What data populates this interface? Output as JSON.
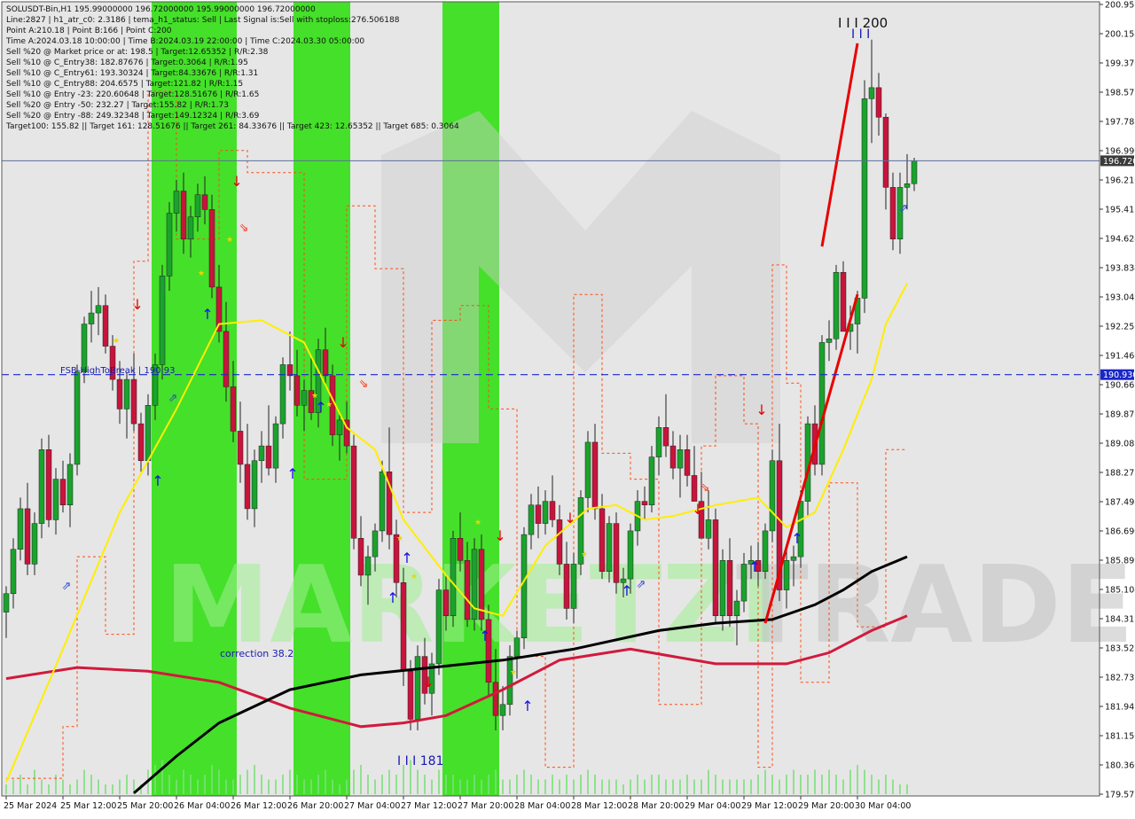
{
  "colors": {
    "background": "#ffffff",
    "plot_background": "#e6e6e6",
    "green_zone": "#45e02a",
    "bull_candle": "#1aa32c",
    "bear_candle": "#c8143c",
    "candle_wick": "#222222",
    "ma_yellow": "#ffee00",
    "ma_red": "#d11a3c",
    "ma_black": "#000000",
    "trend_red": "#e80000",
    "envelope": "#ff4a12",
    "volume": "#7be07b",
    "fsb_line": "#1a26c8",
    "price_label_bg": "#1a26c8",
    "current_label_bg": "#3a3a3a",
    "info_text": "#111111",
    "blue_text": "#1a1ab4",
    "watermark": "#d0d0d0",
    "watermark_green": "#9fef90"
  },
  "header_lines": [
    "SOLUSDT-Bin,H1  195.99000000 196.72000000 195.99000000 196.72000000",
    "Line:2827  |  h1_atr_c0: 2.3186  |  tema_h1_status: Sell  |  Last Signal is:Sell with stoploss:276.506188",
    "Point A:210.18  |  Point B:166  |  Point C:200",
    "Time A:2024.03.18 10:00:00  |  Time B:2024.03.19 22:00:00  |  Time C:2024.03.30 05:00:00",
    "Sell %20 @ Market price or at: 198.5  |  Target:12.65352  |  R/R:2.38",
    "Sell %10 @ C_Entry38: 182.87676  |  Target:0.3064  |  R/R:1.95",
    "Sell %10 @ C_Entry61: 193.30324  |  Target:84.33676  |  R/R:1.31",
    "Sell %10 @ C_Entry88: 204.6575  |  Target:121.82  |  R/R:1.15",
    "Sell %10 @ Entry -23: 220.60648  |  Target:128.51676  |  R/R:1.65",
    "Sell %20 @ Entry -50: 232.27  |  Target:155.82  |  R/R:1.73",
    "Sell %20 @ Entry -88: 249.32348  |  Target:149.12324  |  R/R:3.69",
    "Target100: 155.82  ||  Target 161: 128.51676  ||  Target 261: 84.33676  ||  Target 423: 12.65352  ||  Target 685: 0.3064"
  ],
  "watermark": {
    "text_left": "MARKETZI",
    "text_right": "TRADE"
  },
  "annotations": {
    "fsb_label": "FSB-HighToBreak | 190.93",
    "correction": "correction 38.2",
    "point_b": "I I I 181",
    "point_c": "I I I 200",
    "point_c_marks": "I I I"
  },
  "price_labels": {
    "current": "196.720",
    "fsb": "190.930"
  },
  "chart_data": {
    "type": "candlestick",
    "symbol": "SOLUSDT-Bin",
    "timeframe": "H1",
    "ylim": [
      179.571,
      200.953
    ],
    "y_ticks": [
      "200.953",
      "200.158",
      "199.370",
      "198.575",
      "197.788",
      "196.999",
      "196.210",
      "195.415",
      "194.624",
      "193.834",
      "193.042",
      "192.253",
      "191.460",
      "190.669",
      "189.876",
      "189.085",
      "188.272",
      "187.498",
      "186.690",
      "185.899",
      "185.108",
      "184.317",
      "183.525",
      "182.733",
      "181.941",
      "181.150",
      "180.360",
      "179.571"
    ],
    "x_ticks": [
      "25 Mar 2024",
      "25 Mar 12:00",
      "25 Mar 20:00",
      "26 Mar 04:00",
      "26 Mar 12:00",
      "26 Mar 20:00",
      "27 Mar 04:00",
      "27 Mar 12:00",
      "27 Mar 20:00",
      "28 Mar 04:00",
      "28 Mar 12:00",
      "28 Mar 20:00",
      "29 Mar 04:00",
      "29 Mar 12:00",
      "29 Mar 20:00",
      "30 Mar 04:00"
    ],
    "current_price": 196.72,
    "fsb_level": 190.93,
    "bars_per_tick": 8,
    "candles_ohlc": [
      [
        184.5,
        185.2,
        183.8,
        185.0
      ],
      [
        185.0,
        186.5,
        184.6,
        186.2
      ],
      [
        186.2,
        187.6,
        185.9,
        187.3
      ],
      [
        187.3,
        188.0,
        185.5,
        185.8
      ],
      [
        185.8,
        187.2,
        185.5,
        186.9
      ],
      [
        186.9,
        189.2,
        186.5,
        188.9
      ],
      [
        188.9,
        189.3,
        186.8,
        187.0
      ],
      [
        187.0,
        188.4,
        186.6,
        188.1
      ],
      [
        188.1,
        188.6,
        187.2,
        187.4
      ],
      [
        187.4,
        188.8,
        186.8,
        188.5
      ],
      [
        188.5,
        191.2,
        188.2,
        191.0
      ],
      [
        191.0,
        192.5,
        190.7,
        192.3
      ],
      [
        192.3,
        193.2,
        191.8,
        192.6
      ],
      [
        192.6,
        193.3,
        192.0,
        192.8
      ],
      [
        192.8,
        193.1,
        191.5,
        191.7
      ],
      [
        191.7,
        192.0,
        190.5,
        190.8
      ],
      [
        190.8,
        191.3,
        189.6,
        190.0
      ],
      [
        190.0,
        191.0,
        189.2,
        190.8
      ],
      [
        190.8,
        191.5,
        189.4,
        189.6
      ],
      [
        189.6,
        189.9,
        188.3,
        188.6
      ],
      [
        188.6,
        190.4,
        188.2,
        190.1
      ],
      [
        190.1,
        191.5,
        189.7,
        191.2
      ],
      [
        191.2,
        193.9,
        190.8,
        193.6
      ],
      [
        193.6,
        195.6,
        193.2,
        195.3
      ],
      [
        195.3,
        196.2,
        194.8,
        195.9
      ],
      [
        195.9,
        196.4,
        194.2,
        194.6
      ],
      [
        194.6,
        195.5,
        194.1,
        195.2
      ],
      [
        195.2,
        196.1,
        194.8,
        195.8
      ],
      [
        195.8,
        196.3,
        195.0,
        195.4
      ],
      [
        195.4,
        195.8,
        193.0,
        193.3
      ],
      [
        193.3,
        193.9,
        191.8,
        192.1
      ],
      [
        192.1,
        192.9,
        190.2,
        190.6
      ],
      [
        190.6,
        191.3,
        189.1,
        189.4
      ],
      [
        189.4,
        190.2,
        188.0,
        188.5
      ],
      [
        188.5,
        189.6,
        187.0,
        187.3
      ],
      [
        187.3,
        188.9,
        186.8,
        188.6
      ],
      [
        188.6,
        189.4,
        188.0,
        189.0
      ],
      [
        189.0,
        190.1,
        188.2,
        188.4
      ],
      [
        188.4,
        189.8,
        188.0,
        189.6
      ],
      [
        189.6,
        191.4,
        189.2,
        191.2
      ],
      [
        191.2,
        192.1,
        190.5,
        190.9
      ],
      [
        190.9,
        191.6,
        189.8,
        190.1
      ],
      [
        190.1,
        190.8,
        189.4,
        190.5
      ],
      [
        190.5,
        191.4,
        189.7,
        189.9
      ],
      [
        189.9,
        191.9,
        189.5,
        191.6
      ],
      [
        191.6,
        192.2,
        190.6,
        190.9
      ],
      [
        190.9,
        191.2,
        189.0,
        189.3
      ],
      [
        189.3,
        189.9,
        188.6,
        189.7
      ],
      [
        189.7,
        190.2,
        188.8,
        189.0
      ],
      [
        189.0,
        189.3,
        186.2,
        186.5
      ],
      [
        186.5,
        187.1,
        185.2,
        185.5
      ],
      [
        185.5,
        186.3,
        184.7,
        186.0
      ],
      [
        186.0,
        186.9,
        185.6,
        186.7
      ],
      [
        186.7,
        188.6,
        186.4,
        188.3
      ],
      [
        188.3,
        189.5,
        186.2,
        186.6
      ],
      [
        186.6,
        187.0,
        184.9,
        185.3
      ],
      [
        185.3,
        185.7,
        182.5,
        182.9
      ],
      [
        182.9,
        183.2,
        181.3,
        181.6
      ],
      [
        181.6,
        183.6,
        181.3,
        183.3
      ],
      [
        183.3,
        183.8,
        182.0,
        182.3
      ],
      [
        182.3,
        183.4,
        181.7,
        183.1
      ],
      [
        183.1,
        185.4,
        182.8,
        185.1
      ],
      [
        185.1,
        185.5,
        184.0,
        184.4
      ],
      [
        184.4,
        186.7,
        184.1,
        186.5
      ],
      [
        186.5,
        187.2,
        185.6,
        185.9
      ],
      [
        185.9,
        186.4,
        184.1,
        184.3
      ],
      [
        184.3,
        186.5,
        184.0,
        186.2
      ],
      [
        186.2,
        186.6,
        184.0,
        184.3
      ],
      [
        184.3,
        184.7,
        182.2,
        182.6
      ],
      [
        182.6,
        183.5,
        181.3,
        181.7
      ],
      [
        181.7,
        182.5,
        181.3,
        182.0
      ],
      [
        182.0,
        183.6,
        181.7,
        183.3
      ],
      [
        183.3,
        184.0,
        182.7,
        183.8
      ],
      [
        183.8,
        186.8,
        183.5,
        186.6
      ],
      [
        186.6,
        187.7,
        186.2,
        187.4
      ],
      [
        187.4,
        187.9,
        186.5,
        186.9
      ],
      [
        186.9,
        187.8,
        186.6,
        187.5
      ],
      [
        187.5,
        188.2,
        186.8,
        187.0
      ],
      [
        187.0,
        187.4,
        185.5,
        185.8
      ],
      [
        185.8,
        186.4,
        184.3,
        184.6
      ],
      [
        184.6,
        186.1,
        184.2,
        185.8
      ],
      [
        185.8,
        187.8,
        185.5,
        187.6
      ],
      [
        187.6,
        189.4,
        187.2,
        189.1
      ],
      [
        189.1,
        189.6,
        187.0,
        187.3
      ],
      [
        187.3,
        187.7,
        185.4,
        185.6
      ],
      [
        185.6,
        187.1,
        185.3,
        186.9
      ],
      [
        186.9,
        187.2,
        185.0,
        185.3
      ],
      [
        185.3,
        185.7,
        184.9,
        185.4
      ],
      [
        185.4,
        186.9,
        185.0,
        186.7
      ],
      [
        186.7,
        187.8,
        186.3,
        187.5
      ],
      [
        187.5,
        187.9,
        187.0,
        187.4
      ],
      [
        187.4,
        189.0,
        187.2,
        188.7
      ],
      [
        188.7,
        189.8,
        188.2,
        189.5
      ],
      [
        189.5,
        190.4,
        188.7,
        189.0
      ],
      [
        189.0,
        189.4,
        188.1,
        188.4
      ],
      [
        188.4,
        189.3,
        187.6,
        188.9
      ],
      [
        188.9,
        189.3,
        187.9,
        188.2
      ],
      [
        188.2,
        189.0,
        187.6,
        187.5
      ],
      [
        187.5,
        188.3,
        186.9,
        186.5
      ],
      [
        186.5,
        187.8,
        186.2,
        187.0
      ],
      [
        187.0,
        187.3,
        184.2,
        184.4
      ],
      [
        184.4,
        186.2,
        184.0,
        185.9
      ],
      [
        185.9,
        186.5,
        184.1,
        184.4
      ],
      [
        184.4,
        185.1,
        183.6,
        184.8
      ],
      [
        184.8,
        186.1,
        184.5,
        185.8
      ],
      [
        185.8,
        186.3,
        185.4,
        185.9
      ],
      [
        185.9,
        186.4,
        185.2,
        185.6
      ],
      [
        185.6,
        186.9,
        185.4,
        186.7
      ],
      [
        186.7,
        188.9,
        186.4,
        188.6
      ],
      [
        188.6,
        189.6,
        184.8,
        185.1
      ],
      [
        185.1,
        186.2,
        184.6,
        185.9
      ],
      [
        185.9,
        186.3,
        185.2,
        186.0
      ],
      [
        186.0,
        187.8,
        185.7,
        187.5
      ],
      [
        187.5,
        189.8,
        187.1,
        189.6
      ],
      [
        189.6,
        190.1,
        188.2,
        188.5
      ],
      [
        188.5,
        192.0,
        188.2,
        191.8
      ],
      [
        191.8,
        192.4,
        191.3,
        191.9
      ],
      [
        191.9,
        193.9,
        191.6,
        193.7
      ],
      [
        193.7,
        194.0,
        192.5,
        192.1
      ],
      [
        192.1,
        192.8,
        191.6,
        192.3
      ],
      [
        192.3,
        193.2,
        191.5,
        193.0
      ],
      [
        193.0,
        198.9,
        192.6,
        198.4
      ],
      [
        198.4,
        200.0,
        197.2,
        198.7
      ],
      [
        198.7,
        199.1,
        197.4,
        197.9
      ],
      [
        197.9,
        198.0,
        195.4,
        196.0
      ],
      [
        196.0,
        196.4,
        194.3,
        194.6
      ],
      [
        194.6,
        196.4,
        194.2,
        196.0
      ],
      [
        196.0,
        196.9,
        195.4,
        196.1
      ],
      [
        196.1,
        196.8,
        195.9,
        196.72
      ]
    ],
    "ma_yellow_points": [
      [
        0,
        179.9
      ],
      [
        8,
        183.5
      ],
      [
        16,
        187.2
      ],
      [
        24,
        190.0
      ],
      [
        30,
        192.3
      ],
      [
        36,
        192.4
      ],
      [
        42,
        191.8
      ],
      [
        48,
        189.5
      ],
      [
        52,
        188.9
      ],
      [
        56,
        187.0
      ],
      [
        62,
        185.5
      ],
      [
        66,
        184.6
      ],
      [
        70,
        184.4
      ],
      [
        76,
        186.3
      ],
      [
        82,
        187.3
      ],
      [
        86,
        187.4
      ],
      [
        90,
        187.0
      ],
      [
        94,
        187.1
      ],
      [
        100,
        187.4
      ],
      [
        106,
        187.6
      ],
      [
        110,
        186.8
      ],
      [
        114,
        187.2
      ],
      [
        118,
        188.9
      ],
      [
        122,
        190.8
      ],
      [
        124,
        192.3
      ],
      [
        127,
        193.4
      ]
    ],
    "ma_red_points": [
      [
        0,
        182.7
      ],
      [
        10,
        183.0
      ],
      [
        20,
        182.9
      ],
      [
        30,
        182.6
      ],
      [
        40,
        181.9
      ],
      [
        50,
        181.4
      ],
      [
        56,
        181.5
      ],
      [
        62,
        181.7
      ],
      [
        70,
        182.4
      ],
      [
        78,
        183.2
      ],
      [
        88,
        183.5
      ],
      [
        100,
        183.1
      ],
      [
        110,
        183.1
      ],
      [
        116,
        183.4
      ],
      [
        122,
        184.0
      ],
      [
        127,
        184.4
      ]
    ],
    "ma_black_points": [
      [
        18,
        179.6
      ],
      [
        24,
        180.6
      ],
      [
        30,
        181.5
      ],
      [
        40,
        182.4
      ],
      [
        50,
        182.8
      ],
      [
        60,
        183.0
      ],
      [
        70,
        183.2
      ],
      [
        80,
        183.5
      ],
      [
        92,
        184.0
      ],
      [
        100,
        184.2
      ],
      [
        108,
        184.3
      ],
      [
        114,
        184.7
      ],
      [
        118,
        185.1
      ],
      [
        122,
        185.6
      ],
      [
        127,
        186.0
      ]
    ],
    "trend_lines": [
      [
        [
          107,
          184.2
        ],
        [
          120,
          193.1
        ]
      ],
      [
        [
          115,
          194.4
        ],
        [
          120,
          199.9
        ]
      ]
    ],
    "envelope_points": [
      [
        0,
        180.0
      ],
      [
        8,
        181.4
      ],
      [
        10,
        186.0
      ],
      [
        14,
        183.9
      ],
      [
        18,
        194.0
      ],
      [
        20,
        198.6
      ],
      [
        24,
        194.6
      ],
      [
        30,
        197.0
      ],
      [
        34,
        196.4
      ],
      [
        40,
        196.4
      ],
      [
        42,
        188.1
      ],
      [
        48,
        195.5
      ],
      [
        52,
        193.8
      ],
      [
        56,
        187.2
      ],
      [
        60,
        192.4
      ],
      [
        64,
        192.8
      ],
      [
        68,
        190.0
      ],
      [
        72,
        183.3
      ],
      [
        76,
        180.3
      ],
      [
        80,
        193.1
      ],
      [
        84,
        188.8
      ],
      [
        88,
        188.1
      ],
      [
        92,
        182.0
      ],
      [
        98,
        189.0
      ],
      [
        100,
        190.9
      ],
      [
        104,
        189.6
      ],
      [
        106,
        180.3
      ],
      [
        108,
        193.9
      ],
      [
        110,
        190.7
      ],
      [
        112,
        182.6
      ],
      [
        116,
        188.0
      ],
      [
        120,
        184.1
      ],
      [
        124,
        188.9
      ],
      [
        127,
        188.9
      ]
    ],
    "green_zones_bars": [
      [
        21,
        33
      ],
      [
        41,
        49
      ],
      [
        62,
        70
      ]
    ],
    "volume_bars": [
      2,
      3,
      4,
      2,
      5,
      3,
      2,
      4,
      3,
      2,
      3,
      5,
      4,
      3,
      2,
      2,
      3,
      4,
      3,
      2,
      5,
      6,
      7,
      4,
      3,
      5,
      4,
      3,
      4,
      6,
      5,
      3,
      3,
      4,
      5,
      6,
      4,
      3,
      3,
      4,
      5,
      4,
      3,
      3,
      4,
      5,
      3,
      2,
      3,
      5,
      6,
      4,
      3,
      4,
      5,
      4,
      6,
      7,
      5,
      4,
      3,
      5,
      4,
      4,
      3,
      3,
      4,
      3,
      4,
      5,
      3,
      3,
      4,
      5,
      4,
      3,
      3,
      4,
      3,
      4,
      3,
      4,
      5,
      4,
      3,
      3,
      3,
      2,
      3,
      4,
      3,
      4,
      4,
      3,
      3,
      3,
      4,
      3,
      3,
      5,
      4,
      3,
      3,
      3,
      3,
      3,
      4,
      5,
      4,
      3,
      4,
      5,
      4,
      4,
      5,
      4,
      5,
      4,
      3,
      5,
      6,
      5,
      4,
      3,
      4,
      3,
      2,
      2
    ]
  }
}
